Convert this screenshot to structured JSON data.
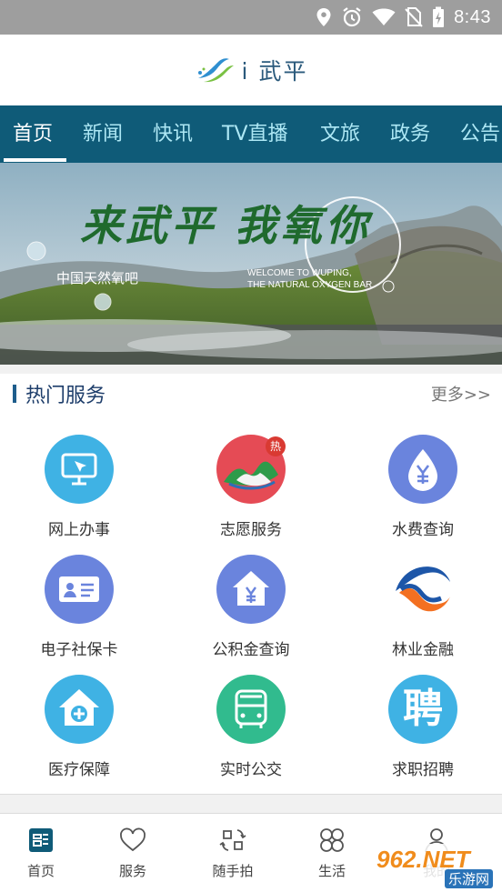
{
  "status_bar": {
    "time": "8:43",
    "icons": [
      "location-icon",
      "alarm-icon",
      "wifi-icon",
      "no-sim-icon",
      "battery-charging-icon"
    ]
  },
  "app": {
    "title": "i 武平"
  },
  "tabs": [
    {
      "label": "首页",
      "active": true
    },
    {
      "label": "新闻",
      "active": false
    },
    {
      "label": "快讯",
      "active": false
    },
    {
      "label": "TV直播",
      "active": false
    },
    {
      "label": "文旅",
      "active": false
    },
    {
      "label": "政务",
      "active": false
    },
    {
      "label": "公告",
      "active": false
    }
  ],
  "banner": {
    "slogan": "来武平 我氧你",
    "subtitle": "中国天然氧吧",
    "english_line1": "WELCOME TO WUPING,",
    "english_line2": "THE NATURAL OXYGEN BAR"
  },
  "services_section": {
    "title": "热门服务",
    "more_label": "更多>>",
    "hot_badge": "热",
    "items": [
      {
        "label": "网上办事",
        "icon": "monitor-icon",
        "color": "#3fb2e4"
      },
      {
        "label": "志愿服务",
        "icon": "volunteer-icon",
        "color": "#e54b55"
      },
      {
        "label": "水费查询",
        "icon": "water-drop-yen-icon",
        "color": "#6a84dd"
      },
      {
        "label": "电子社保卡",
        "icon": "id-card-icon",
        "color": "#6a84dd"
      },
      {
        "label": "公积金查询",
        "icon": "house-yen-icon",
        "color": "#6a84dd"
      },
      {
        "label": "林业金融",
        "icon": "forestry-finance-logo-icon",
        "color": "#1d56a8"
      },
      {
        "label": "医疗保障",
        "icon": "medical-house-icon",
        "color": "#3fb2e4"
      },
      {
        "label": "实时公交",
        "icon": "bus-icon",
        "color": "#31bb8e"
      },
      {
        "label": "求职招聘",
        "icon": "recruit-icon",
        "color": "#3fb2e4",
        "glyph": "聘"
      }
    ]
  },
  "bottom_nav": [
    {
      "label": "首页",
      "icon": "home-icon",
      "active": true
    },
    {
      "label": "服务",
      "icon": "heart-icon",
      "active": false
    },
    {
      "label": "随手拍",
      "icon": "snapshot-icon",
      "active": false
    },
    {
      "label": "生活",
      "icon": "clover-icon",
      "active": false
    },
    {
      "label": "我的",
      "icon": "user-icon",
      "active": false
    }
  ],
  "watermark": {
    "brand": "962.NET",
    "sub": "乐游网"
  }
}
